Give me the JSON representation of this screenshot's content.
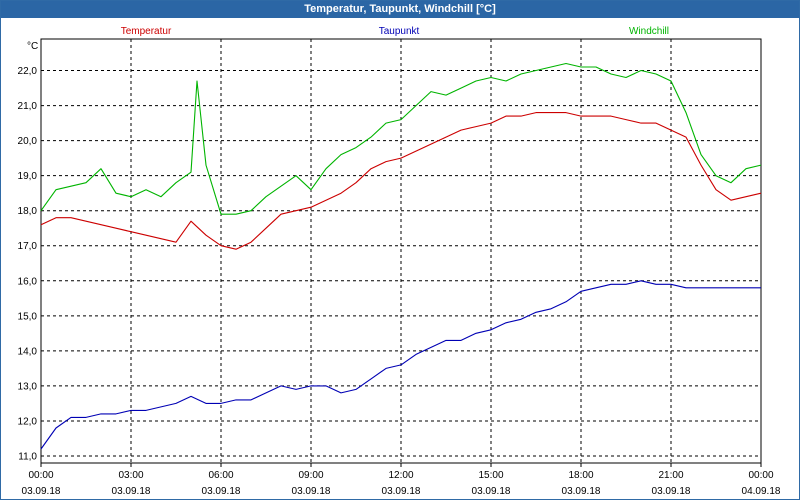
{
  "window": {
    "title": "Temperatur, Taupunkt, Windchill [°C]"
  },
  "chart_data": {
    "type": "line",
    "title": "Temperatur, Taupunkt, Windchill [°C]",
    "ylabel": "°C",
    "ylim": [
      10.8,
      22.9
    ],
    "yticks": [
      "22,0",
      "21,0",
      "20,0",
      "19,0",
      "18,0",
      "17,0",
      "16,0",
      "15,0",
      "14,0",
      "13,0",
      "12,0",
      "11,0"
    ],
    "yticks_values": [
      22,
      21,
      20,
      19,
      18,
      17,
      16,
      15,
      14,
      13,
      12,
      11
    ],
    "xlim_hours": [
      0,
      24
    ],
    "xticks": [
      {
        "time": "00:00",
        "date": "03.09.18"
      },
      {
        "time": "03:00",
        "date": "03.09.18"
      },
      {
        "time": "06:00",
        "date": "03.09.18"
      },
      {
        "time": "09:00",
        "date": "03.09.18"
      },
      {
        "time": "12:00",
        "date": "03.09.18"
      },
      {
        "time": "15:00",
        "date": "03.09.18"
      },
      {
        "time": "18:00",
        "date": "03.09.18"
      },
      {
        "time": "21:00",
        "date": "03.09.18"
      },
      {
        "time": "00:00",
        "date": "04.09.18"
      }
    ],
    "grid": true,
    "legend_position": "top",
    "series": [
      {
        "name": "Temperatur",
        "color": "#cc0000",
        "x": [
          0,
          0.5,
          1,
          1.5,
          2,
          2.5,
          3,
          3.5,
          4,
          4.5,
          5,
          5.5,
          6,
          6.5,
          7,
          7.5,
          8,
          8.5,
          9,
          9.5,
          10,
          10.5,
          11,
          11.5,
          12,
          12.5,
          13,
          13.5,
          14,
          14.5,
          15,
          15.5,
          16,
          16.5,
          17,
          17.5,
          18,
          18.5,
          19,
          19.5,
          20,
          20.5,
          21,
          21.5,
          22,
          22.5,
          23,
          23.5,
          24
        ],
        "values": [
          17.6,
          17.8,
          17.8,
          17.7,
          17.6,
          17.5,
          17.4,
          17.3,
          17.2,
          17.1,
          17.7,
          17.3,
          17.0,
          16.9,
          17.1,
          17.5,
          17.9,
          18.0,
          18.1,
          18.3,
          18.5,
          18.8,
          19.2,
          19.4,
          19.5,
          19.7,
          19.9,
          20.1,
          20.3,
          20.4,
          20.5,
          20.7,
          20.7,
          20.8,
          20.8,
          20.8,
          20.7,
          20.7,
          20.7,
          20.6,
          20.5,
          20.5,
          20.3,
          20.1,
          19.3,
          18.6,
          18.3,
          18.4,
          18.5
        ]
      },
      {
        "name": "Taupunkt",
        "color": "#0000b4",
        "x": [
          0,
          0.5,
          1,
          1.5,
          2,
          2.5,
          3,
          3.5,
          4,
          4.5,
          5,
          5.5,
          6,
          6.5,
          7,
          7.5,
          8,
          8.5,
          9,
          9.5,
          10,
          10.5,
          11,
          11.5,
          12,
          12.5,
          13,
          13.5,
          14,
          14.5,
          15,
          15.5,
          16,
          16.5,
          17,
          17.5,
          18,
          18.5,
          19,
          19.5,
          20,
          20.5,
          21,
          21.5,
          22,
          22.5,
          23,
          23.5,
          24
        ],
        "values": [
          11.2,
          11.8,
          12.1,
          12.1,
          12.2,
          12.2,
          12.3,
          12.3,
          12.4,
          12.5,
          12.7,
          12.5,
          12.5,
          12.6,
          12.6,
          12.8,
          13.0,
          12.9,
          13.0,
          13.0,
          12.8,
          12.9,
          13.2,
          13.5,
          13.6,
          13.9,
          14.1,
          14.3,
          14.3,
          14.5,
          14.6,
          14.8,
          14.9,
          15.1,
          15.2,
          15.4,
          15.7,
          15.8,
          15.9,
          15.9,
          16.0,
          15.9,
          15.9,
          15.8,
          15.8,
          15.8,
          15.8,
          15.8,
          15.8
        ]
      },
      {
        "name": "Windchill",
        "color": "#00b400",
        "x": [
          0,
          0.5,
          1,
          1.5,
          2,
          2.5,
          3,
          3.5,
          4,
          4.5,
          5,
          5.2,
          5.5,
          6,
          6.5,
          7,
          7.5,
          8,
          8.5,
          9,
          9.5,
          10,
          10.5,
          11,
          11.5,
          12,
          12.5,
          13,
          13.5,
          14,
          14.5,
          15,
          15.5,
          16,
          16.5,
          17,
          17.5,
          18,
          18.5,
          19,
          19.5,
          20,
          20.5,
          21,
          21.5,
          22,
          22.5,
          23,
          23.5,
          24
        ],
        "values": [
          18.0,
          18.6,
          18.7,
          18.8,
          19.2,
          18.5,
          18.4,
          18.6,
          18.4,
          18.8,
          19.1,
          21.7,
          19.3,
          17.9,
          17.9,
          18.0,
          18.4,
          18.7,
          19.0,
          18.6,
          19.2,
          19.6,
          19.8,
          20.1,
          20.5,
          20.6,
          21.0,
          21.4,
          21.3,
          21.5,
          21.7,
          21.8,
          21.7,
          21.9,
          22.0,
          22.1,
          22.2,
          22.1,
          22.1,
          21.9,
          21.8,
          22.0,
          21.9,
          21.7,
          20.8,
          19.6,
          19.0,
          18.8,
          19.2,
          19.3
        ]
      }
    ]
  }
}
